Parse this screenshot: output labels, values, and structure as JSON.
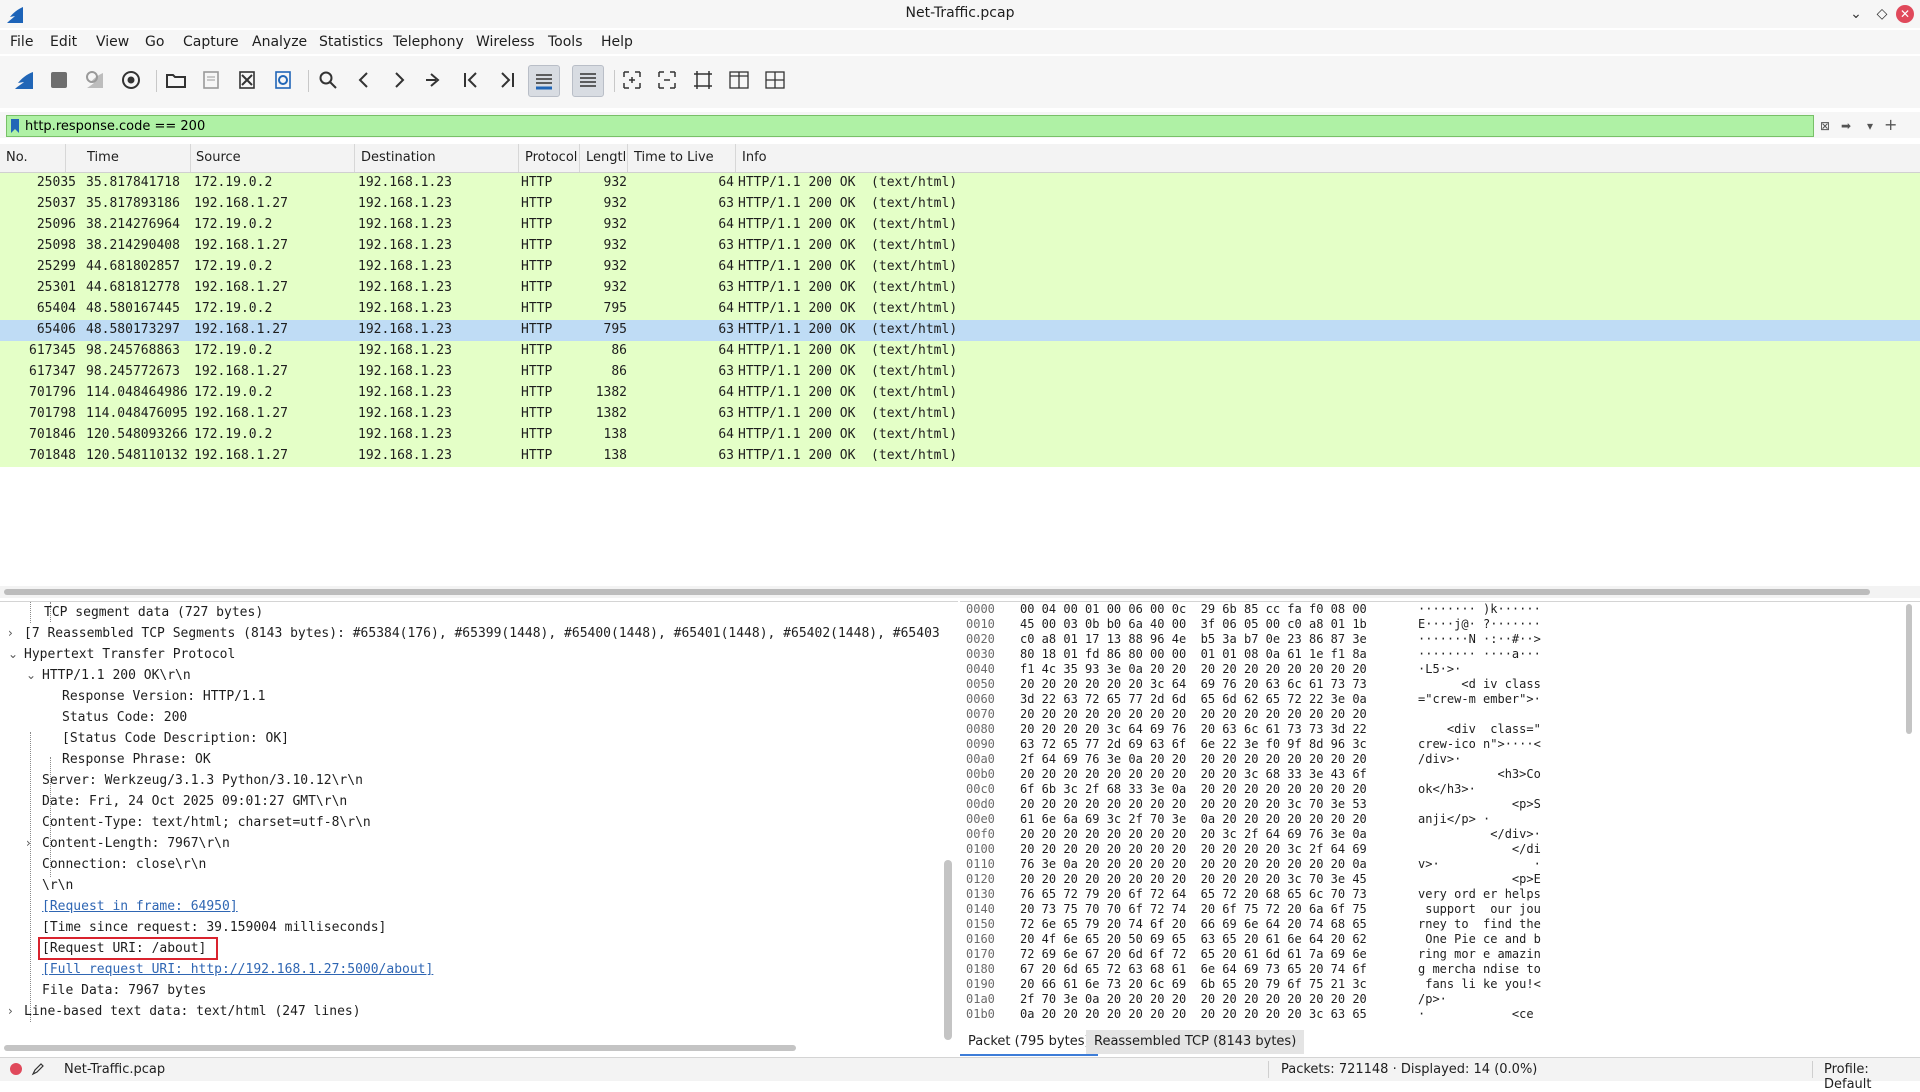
{
  "window": {
    "title": "Net-Traffic.pcap"
  },
  "menu": [
    "File",
    "Edit",
    "View",
    "Go",
    "Capture",
    "Analyze",
    "Statistics",
    "Telephony",
    "Wireless",
    "Tools",
    "Help"
  ],
  "toolbar": {
    "icons": [
      "start-capture",
      "stop-capture",
      "restart-capture",
      "capture-options",
      "open-file",
      "save-file",
      "close-file",
      "reload-file",
      "find-packet",
      "go-back",
      "go-forward",
      "go-to-packet",
      "go-first",
      "go-last",
      "auto-scroll",
      "colorize",
      "zoom-in",
      "zoom-out",
      "normal-size",
      "resize-columns",
      "layout"
    ]
  },
  "filter": {
    "value": "http.response.code == 200"
  },
  "packet_list": {
    "columns": [
      "No.",
      "Time",
      "Source",
      "Destination",
      "Protocol",
      "Lengtl",
      "Time to Live",
      "Info"
    ],
    "rows": [
      {
        "no": "25035",
        "time": "35.817841718",
        "src": "172.19.0.2",
        "dst": "192.168.1.23",
        "proto": "HTTP",
        "len": "932",
        "ttl": "64",
        "info": "HTTP/1.1 200 OK  (text/html)"
      },
      {
        "no": "25037",
        "time": "35.817893186",
        "src": "192.168.1.27",
        "dst": "192.168.1.23",
        "proto": "HTTP",
        "len": "932",
        "ttl": "63",
        "info": "HTTP/1.1 200 OK  (text/html)"
      },
      {
        "no": "25096",
        "time": "38.214276964",
        "src": "172.19.0.2",
        "dst": "192.168.1.23",
        "proto": "HTTP",
        "len": "932",
        "ttl": "64",
        "info": "HTTP/1.1 200 OK  (text/html)"
      },
      {
        "no": "25098",
        "time": "38.214290408",
        "src": "192.168.1.27",
        "dst": "192.168.1.23",
        "proto": "HTTP",
        "len": "932",
        "ttl": "63",
        "info": "HTTP/1.1 200 OK  (text/html)"
      },
      {
        "no": "25299",
        "time": "44.681802857",
        "src": "172.19.0.2",
        "dst": "192.168.1.23",
        "proto": "HTTP",
        "len": "932",
        "ttl": "64",
        "info": "HTTP/1.1 200 OK  (text/html)"
      },
      {
        "no": "25301",
        "time": "44.681812778",
        "src": "192.168.1.27",
        "dst": "192.168.1.23",
        "proto": "HTTP",
        "len": "932",
        "ttl": "63",
        "info": "HTTP/1.1 200 OK  (text/html)"
      },
      {
        "no": "65404",
        "time": "48.580167445",
        "src": "172.19.0.2",
        "dst": "192.168.1.23",
        "proto": "HTTP",
        "len": "795",
        "ttl": "64",
        "info": "HTTP/1.1 200 OK  (text/html)"
      },
      {
        "no": "65406",
        "time": "48.580173297",
        "src": "192.168.1.27",
        "dst": "192.168.1.23",
        "proto": "HTTP",
        "len": "795",
        "ttl": "63",
        "info": "HTTP/1.1 200 OK  (text/html)"
      },
      {
        "no": "617345",
        "time": "98.245768863",
        "src": "172.19.0.2",
        "dst": "192.168.1.23",
        "proto": "HTTP",
        "len": "86",
        "ttl": "64",
        "info": "HTTP/1.1 200 OK  (text/html)"
      },
      {
        "no": "617347",
        "time": "98.245772673",
        "src": "192.168.1.27",
        "dst": "192.168.1.23",
        "proto": "HTTP",
        "len": "86",
        "ttl": "63",
        "info": "HTTP/1.1 200 OK  (text/html)"
      },
      {
        "no": "701796",
        "time": "114.048464986",
        "src": "172.19.0.2",
        "dst": "192.168.1.23",
        "proto": "HTTP",
        "len": "1382",
        "ttl": "64",
        "info": "HTTP/1.1 200 OK  (text/html)"
      },
      {
        "no": "701798",
        "time": "114.048476095",
        "src": "192.168.1.27",
        "dst": "192.168.1.23",
        "proto": "HTTP",
        "len": "1382",
        "ttl": "63",
        "info": "HTTP/1.1 200 OK  (text/html)"
      },
      {
        "no": "701846",
        "time": "120.548093266",
        "src": "172.19.0.2",
        "dst": "192.168.1.23",
        "proto": "HTTP",
        "len": "138",
        "ttl": "64",
        "info": "HTTP/1.1 200 OK  (text/html)"
      },
      {
        "no": "701848",
        "time": "120.548110132",
        "src": "192.168.1.27",
        "dst": "192.168.1.23",
        "proto": "HTTP",
        "len": "138",
        "ttl": "63",
        "info": "HTTP/1.1 200 OK  (text/html)"
      }
    ],
    "selected_no": "65406"
  },
  "details": {
    "lines": [
      {
        "text": "TCP segment data (727 bytes)",
        "arrow": ""
      },
      {
        "text": "[7 Reassembled TCP Segments (8143 bytes): #65384(176), #65399(1448), #65400(1448), #65401(1448), #65402(1448), #65403",
        "arrow": "collapsed"
      },
      {
        "text": "Hypertext Transfer Protocol",
        "arrow": "expanded"
      },
      {
        "text": "HTTP/1.1 200 OK\\r\\n",
        "arrow": "expanded"
      },
      {
        "text": "Response Version: HTTP/1.1",
        "arrow": ""
      },
      {
        "text": "Status Code: 200",
        "arrow": ""
      },
      {
        "text": "[Status Code Description: OK]",
        "arrow": ""
      },
      {
        "text": "Response Phrase: OK",
        "arrow": ""
      },
      {
        "text": "Server: Werkzeug/3.1.3 Python/3.10.12\\r\\n",
        "arrow": ""
      },
      {
        "text": "Date: Fri, 24 Oct 2025 09:01:27 GMT\\r\\n",
        "arrow": ""
      },
      {
        "text": "Content-Type: text/html; charset=utf-8\\r\\n",
        "arrow": ""
      },
      {
        "text": "Content-Length: 7967\\r\\n",
        "arrow": "collapsed"
      },
      {
        "text": "Connection: close\\r\\n",
        "arrow": ""
      },
      {
        "text": "\\r\\n",
        "arrow": ""
      },
      {
        "text": "[Request in frame: 64950]",
        "arrow": "",
        "link": true
      },
      {
        "text": "[Time since request: 39.159004 milliseconds]",
        "arrow": ""
      },
      {
        "text": "[Request URI: /about]",
        "arrow": "",
        "highlight": true
      },
      {
        "text": "[Full request URI: http://192.168.1.27:5000/about]",
        "arrow": "",
        "link": true
      },
      {
        "text": "File Data: 7967 bytes",
        "arrow": ""
      },
      {
        "text": "Line-based text data: text/html (247 lines)",
        "arrow": "collapsed"
      }
    ]
  },
  "bytes": {
    "rows": [
      {
        "off": "0000",
        "hex": "00 04 00 01 00 06 00 0c  29 6b 85 cc fa f0 08 00",
        "ascii": "········ )k······"
      },
      {
        "off": "0010",
        "hex": "45 00 03 0b b0 6a 40 00  3f 06 05 00 c0 a8 01 1b",
        "ascii": "E····j@· ?·······"
      },
      {
        "off": "0020",
        "hex": "c0 a8 01 17 13 88 96 4e  b5 3a b7 0e 23 86 87 3e",
        "ascii": "·······N ·:··#··>"
      },
      {
        "off": "0030",
        "hex": "80 18 01 fd 86 80 00 00  01 01 08 0a 61 1e f1 8a",
        "ascii": "········ ····a···"
      },
      {
        "off": "0040",
        "hex": "f1 4c 35 93 3e 0a 20 20  20 20 20 20 20 20 20 20",
        "ascii": "·L5·>·          "
      },
      {
        "off": "0050",
        "hex": "20 20 20 20 20 20 3c 64  69 76 20 63 6c 61 73 73",
        "ascii": "      <d iv class"
      },
      {
        "off": "0060",
        "hex": "3d 22 63 72 65 77 2d 6d  65 6d 62 65 72 22 3e 0a",
        "ascii": "=\"crew-m ember\">·"
      },
      {
        "off": "0070",
        "hex": "20 20 20 20 20 20 20 20  20 20 20 20 20 20 20 20",
        "ascii": "                 "
      },
      {
        "off": "0080",
        "hex": "20 20 20 20 3c 64 69 76  20 63 6c 61 73 73 3d 22",
        "ascii": "    <div  class=\""
      },
      {
        "off": "0090",
        "hex": "63 72 65 77 2d 69 63 6f  6e 22 3e f0 9f 8d 96 3c",
        "ascii": "crew-ico n\">····<"
      },
      {
        "off": "00a0",
        "hex": "2f 64 69 76 3e 0a 20 20  20 20 20 20 20 20 20 20",
        "ascii": "/div>·           "
      },
      {
        "off": "00b0",
        "hex": "20 20 20 20 20 20 20 20  20 20 3c 68 33 3e 43 6f",
        "ascii": "           <h3>Co"
      },
      {
        "off": "00c0",
        "hex": "6f 6b 3c 2f 68 33 3e 0a  20 20 20 20 20 20 20 20",
        "ascii": "ok</h3>·         "
      },
      {
        "off": "00d0",
        "hex": "20 20 20 20 20 20 20 20  20 20 20 20 3c 70 3e 53",
        "ascii": "             <p>S"
      },
      {
        "off": "00e0",
        "hex": "61 6e 6a 69 3c 2f 70 3e  0a 20 20 20 20 20 20 20",
        "ascii": "anji</p> ·       "
      },
      {
        "off": "00f0",
        "hex": "20 20 20 20 20 20 20 20  20 3c 2f 64 69 76 3e 0a",
        "ascii": "          </div>·"
      },
      {
        "off": "0100",
        "hex": "20 20 20 20 20 20 20 20  20 20 20 20 3c 2f 64 69",
        "ascii": "             </di"
      },
      {
        "off": "0110",
        "hex": "76 3e 0a 20 20 20 20 20  20 20 20 20 20 20 20 0a",
        "ascii": "v>·             ·"
      },
      {
        "off": "0120",
        "hex": "20 20 20 20 20 20 20 20  20 20 20 20 3c 70 3e 45",
        "ascii": "             <p>E"
      },
      {
        "off": "0130",
        "hex": "76 65 72 79 20 6f 72 64  65 72 20 68 65 6c 70 73",
        "ascii": "very ord er helps"
      },
      {
        "off": "0140",
        "hex": "20 73 75 70 70 6f 72 74  20 6f 75 72 20 6a 6f 75",
        "ascii": " support  our jou"
      },
      {
        "off": "0150",
        "hex": "72 6e 65 79 20 74 6f 20  66 69 6e 64 20 74 68 65",
        "ascii": "rney to  find the"
      },
      {
        "off": "0160",
        "hex": "20 4f 6e 65 20 50 69 65  63 65 20 61 6e 64 20 62",
        "ascii": " One Pie ce and b"
      },
      {
        "off": "0170",
        "hex": "72 69 6e 67 20 6d 6f 72  65 20 61 6d 61 7a 69 6e",
        "ascii": "ring mor e amazin"
      },
      {
        "off": "0180",
        "hex": "67 20 6d 65 72 63 68 61  6e 64 69 73 65 20 74 6f",
        "ascii": "g mercha ndise to"
      },
      {
        "off": "0190",
        "hex": "20 66 61 6e 73 20 6c 69  6b 65 20 79 6f 75 21 3c",
        "ascii": " fans li ke you!<"
      },
      {
        "off": "01a0",
        "hex": "2f 70 3e 0a 20 20 20 20  20 20 20 20 20 20 20 20",
        "ascii": "/p>·             "
      },
      {
        "off": "01b0",
        "hex": "0a 20 20 20 20 20 20 20  20 20 20 20 20 3c 63 65",
        "ascii": "·            <ce"
      }
    ],
    "tabs": [
      "Packet (795 bytes)",
      "Reassembled TCP (8143 bytes)"
    ]
  },
  "status": {
    "file": "Net-Traffic.pcap",
    "packets": "Packets: 721148 · Displayed: 14 (0.0%)",
    "profile": "Profile: Default"
  },
  "colors": {
    "row_bg": "#e4ffc7",
    "selected_bg": "#bfdcf5",
    "filter_bg": "#aff1a5",
    "highlight_box": "#d9232e"
  }
}
